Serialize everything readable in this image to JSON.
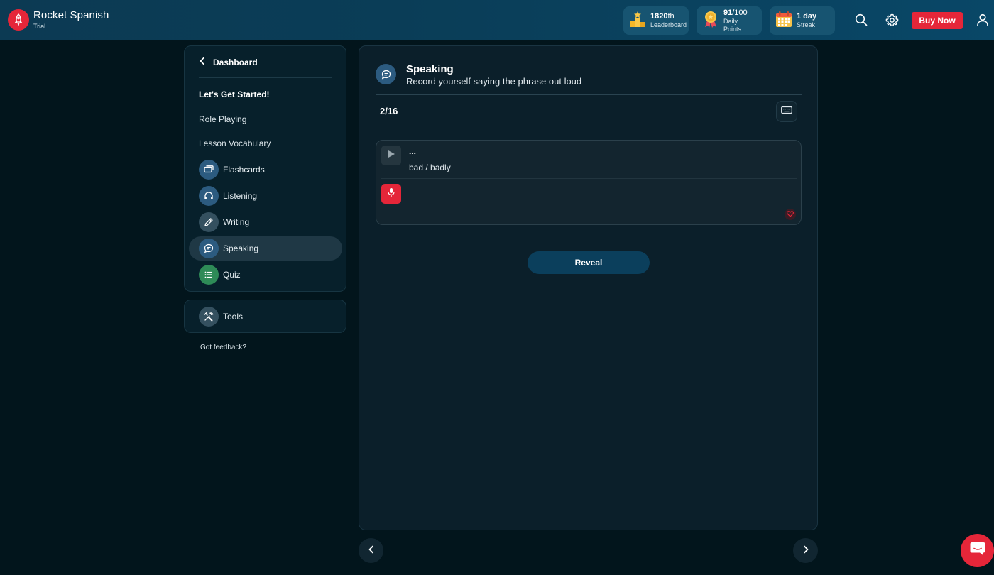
{
  "brand": {
    "title": "Rocket Spanish",
    "subtitle": "Trial",
    "logo_icon": "rocket-icon"
  },
  "header_stats": [
    {
      "value": "1820",
      "suffix": "th",
      "label": "Leaderboard",
      "icon": "podium-icon"
    },
    {
      "value": "91",
      "suffix": "/100",
      "label": "Daily Points",
      "icon": "medal-icon"
    },
    {
      "value": "1 day",
      "suffix": "",
      "label": "Streak",
      "icon": "calendar-icon"
    }
  ],
  "header_actions": {
    "buy_label": "Buy Now"
  },
  "sidebar": {
    "back_label": "Dashboard",
    "heading": "Let's Get Started!",
    "links": [
      "Role Playing",
      "Lesson Vocabulary"
    ],
    "items": [
      {
        "label": "Flashcards",
        "icon": "cards-icon",
        "color": "#2c5b80",
        "active": false
      },
      {
        "label": "Listening",
        "icon": "headphones-icon",
        "color": "#2c5b80",
        "active": false
      },
      {
        "label": "Writing",
        "icon": "pencil-icon",
        "color": "#34505f",
        "active": false
      },
      {
        "label": "Speaking",
        "icon": "speech-bubble-icon",
        "color": "#2c5b80",
        "active": true
      },
      {
        "label": "Quiz",
        "icon": "list-icon",
        "color": "#2e8b57",
        "active": false
      }
    ],
    "tools_label": "Tools",
    "feedback_label": "Got feedback?"
  },
  "activity": {
    "title": "Speaking",
    "subtitle": "Record yourself saying the phrase out loud",
    "progress": "2/16",
    "phrase_native": "...",
    "phrase_english": "bad / badly",
    "reveal_label": "Reveal"
  },
  "colors": {
    "accent_red": "#e52639",
    "header_bg": "#0a3d57",
    "page_bg": "#02151c",
    "reveal_bg": "#0b3f5c"
  }
}
